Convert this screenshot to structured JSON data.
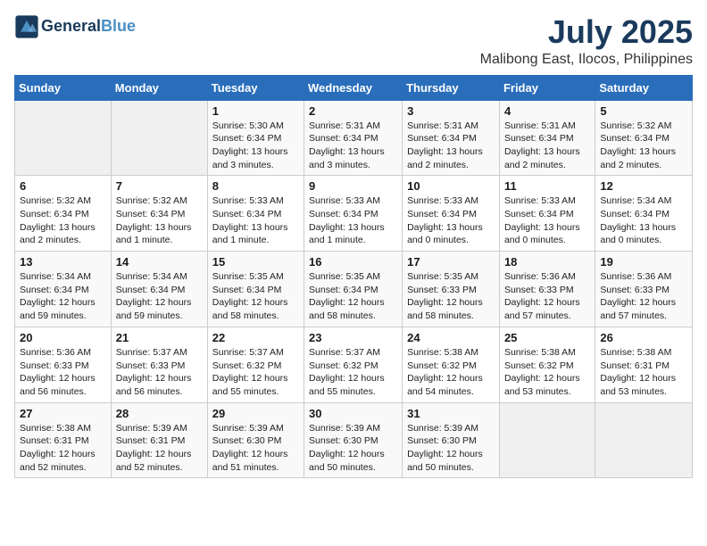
{
  "logo": {
    "line1": "General",
    "line2": "Blue"
  },
  "title": "July 2025",
  "location": "Malibong East, Ilocos, Philippines",
  "days_header": [
    "Sunday",
    "Monday",
    "Tuesday",
    "Wednesday",
    "Thursday",
    "Friday",
    "Saturday"
  ],
  "weeks": [
    [
      {
        "day": "",
        "info": ""
      },
      {
        "day": "",
        "info": ""
      },
      {
        "day": "1",
        "info": "Sunrise: 5:30 AM\nSunset: 6:34 PM\nDaylight: 13 hours and 3 minutes."
      },
      {
        "day": "2",
        "info": "Sunrise: 5:31 AM\nSunset: 6:34 PM\nDaylight: 13 hours and 3 minutes."
      },
      {
        "day": "3",
        "info": "Sunrise: 5:31 AM\nSunset: 6:34 PM\nDaylight: 13 hours and 2 minutes."
      },
      {
        "day": "4",
        "info": "Sunrise: 5:31 AM\nSunset: 6:34 PM\nDaylight: 13 hours and 2 minutes."
      },
      {
        "day": "5",
        "info": "Sunrise: 5:32 AM\nSunset: 6:34 PM\nDaylight: 13 hours and 2 minutes."
      }
    ],
    [
      {
        "day": "6",
        "info": "Sunrise: 5:32 AM\nSunset: 6:34 PM\nDaylight: 13 hours and 2 minutes."
      },
      {
        "day": "7",
        "info": "Sunrise: 5:32 AM\nSunset: 6:34 PM\nDaylight: 13 hours and 1 minute."
      },
      {
        "day": "8",
        "info": "Sunrise: 5:33 AM\nSunset: 6:34 PM\nDaylight: 13 hours and 1 minute."
      },
      {
        "day": "9",
        "info": "Sunrise: 5:33 AM\nSunset: 6:34 PM\nDaylight: 13 hours and 1 minute."
      },
      {
        "day": "10",
        "info": "Sunrise: 5:33 AM\nSunset: 6:34 PM\nDaylight: 13 hours and 0 minutes."
      },
      {
        "day": "11",
        "info": "Sunrise: 5:33 AM\nSunset: 6:34 PM\nDaylight: 13 hours and 0 minutes."
      },
      {
        "day": "12",
        "info": "Sunrise: 5:34 AM\nSunset: 6:34 PM\nDaylight: 13 hours and 0 minutes."
      }
    ],
    [
      {
        "day": "13",
        "info": "Sunrise: 5:34 AM\nSunset: 6:34 PM\nDaylight: 12 hours and 59 minutes."
      },
      {
        "day": "14",
        "info": "Sunrise: 5:34 AM\nSunset: 6:34 PM\nDaylight: 12 hours and 59 minutes."
      },
      {
        "day": "15",
        "info": "Sunrise: 5:35 AM\nSunset: 6:34 PM\nDaylight: 12 hours and 58 minutes."
      },
      {
        "day": "16",
        "info": "Sunrise: 5:35 AM\nSunset: 6:34 PM\nDaylight: 12 hours and 58 minutes."
      },
      {
        "day": "17",
        "info": "Sunrise: 5:35 AM\nSunset: 6:33 PM\nDaylight: 12 hours and 58 minutes."
      },
      {
        "day": "18",
        "info": "Sunrise: 5:36 AM\nSunset: 6:33 PM\nDaylight: 12 hours and 57 minutes."
      },
      {
        "day": "19",
        "info": "Sunrise: 5:36 AM\nSunset: 6:33 PM\nDaylight: 12 hours and 57 minutes."
      }
    ],
    [
      {
        "day": "20",
        "info": "Sunrise: 5:36 AM\nSunset: 6:33 PM\nDaylight: 12 hours and 56 minutes."
      },
      {
        "day": "21",
        "info": "Sunrise: 5:37 AM\nSunset: 6:33 PM\nDaylight: 12 hours and 56 minutes."
      },
      {
        "day": "22",
        "info": "Sunrise: 5:37 AM\nSunset: 6:32 PM\nDaylight: 12 hours and 55 minutes."
      },
      {
        "day": "23",
        "info": "Sunrise: 5:37 AM\nSunset: 6:32 PM\nDaylight: 12 hours and 55 minutes."
      },
      {
        "day": "24",
        "info": "Sunrise: 5:38 AM\nSunset: 6:32 PM\nDaylight: 12 hours and 54 minutes."
      },
      {
        "day": "25",
        "info": "Sunrise: 5:38 AM\nSunset: 6:32 PM\nDaylight: 12 hours and 53 minutes."
      },
      {
        "day": "26",
        "info": "Sunrise: 5:38 AM\nSunset: 6:31 PM\nDaylight: 12 hours and 53 minutes."
      }
    ],
    [
      {
        "day": "27",
        "info": "Sunrise: 5:38 AM\nSunset: 6:31 PM\nDaylight: 12 hours and 52 minutes."
      },
      {
        "day": "28",
        "info": "Sunrise: 5:39 AM\nSunset: 6:31 PM\nDaylight: 12 hours and 52 minutes."
      },
      {
        "day": "29",
        "info": "Sunrise: 5:39 AM\nSunset: 6:30 PM\nDaylight: 12 hours and 51 minutes."
      },
      {
        "day": "30",
        "info": "Sunrise: 5:39 AM\nSunset: 6:30 PM\nDaylight: 12 hours and 50 minutes."
      },
      {
        "day": "31",
        "info": "Sunrise: 5:39 AM\nSunset: 6:30 PM\nDaylight: 12 hours and 50 minutes."
      },
      {
        "day": "",
        "info": ""
      },
      {
        "day": "",
        "info": ""
      }
    ]
  ]
}
